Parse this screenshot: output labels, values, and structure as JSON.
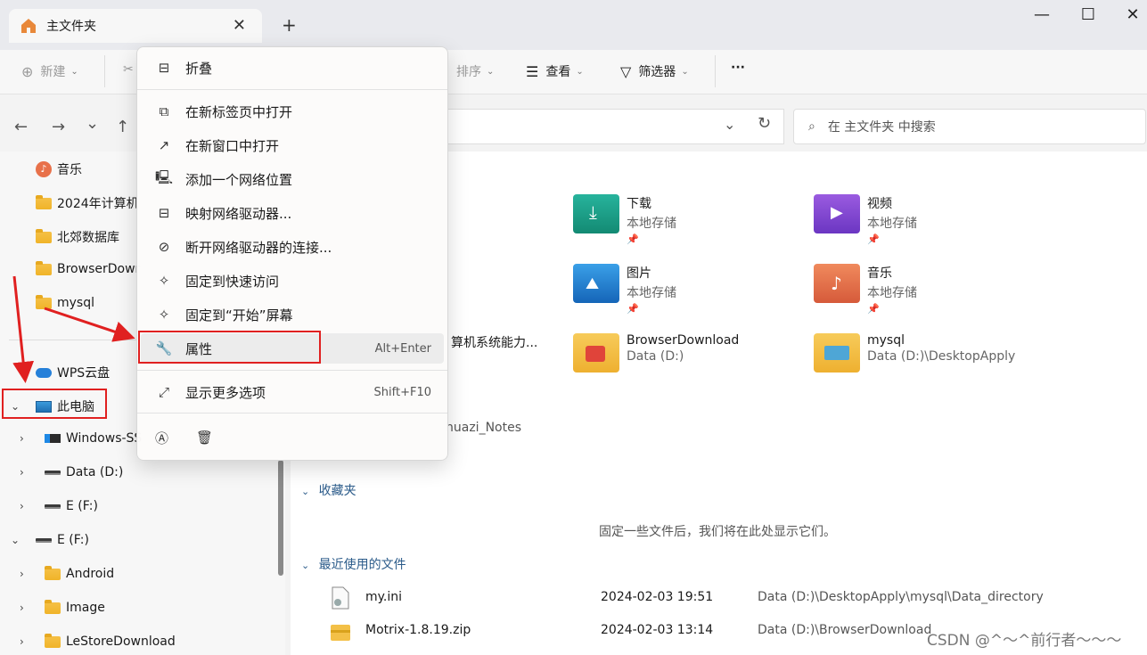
{
  "tab": {
    "title": "主文件夹",
    "close": "✕",
    "new_tab": "+"
  },
  "window": {
    "minimize": "—",
    "maximize": "☐",
    "close": "✕"
  },
  "toolbar": {
    "new": "新建",
    "sort": "排序",
    "view": "查看",
    "filter": "筛选器",
    "more": "···"
  },
  "nav": {
    "back": "←",
    "forward": "→",
    "recent": "⌄",
    "up": "↑",
    "addr_dropdown": "⌄",
    "refresh": "↻"
  },
  "search": {
    "placeholder": "在 主文件夹 中搜索"
  },
  "sidebar": {
    "music": "音乐",
    "folder1": "2024年计算机",
    "folder2": "北郊数据库",
    "folder3": "BrowserDowr",
    "folder4": "mysql",
    "wps": "WPS云盘",
    "this_pc": "此电脑",
    "windows": "Windows-SS",
    "data_d": "Data (D:)",
    "e_f1": "E (F:)",
    "e_f2": "E (F:)",
    "android": "Android",
    "image": "Image",
    "lestore": "LeStoreDownload"
  },
  "tiles": [
    {
      "name": "下载",
      "sub": "本地存储"
    },
    {
      "name": "视频",
      "sub": "本地存储"
    },
    {
      "name": "图片",
      "sub": "本地存储"
    },
    {
      "name": "音乐",
      "sub": "本地存储"
    },
    {
      "name": "BrowserDownload",
      "sub": "Data (D:)"
    },
    {
      "name": "mysql",
      "sub": "Data (D:)\\DesktopApply"
    }
  ],
  "partial": {
    "a": "算机系统能力...",
    "b": "huazi_Notes"
  },
  "sections": {
    "favorites": "收藏夹",
    "recent": "最近使用的文件",
    "empty_note": "固定一些文件后，我们将在此处显示它们。"
  },
  "recent_files": [
    {
      "name": "my.ini",
      "date": "2024-02-03 19:51",
      "path": "Data (D:)\\DesktopApply\\mysql\\Data_directory"
    },
    {
      "name": "Motrix-1.8.19.zip",
      "date": "2024-02-03 13:14",
      "path": "Data (D:)\\BrowserDownload"
    }
  ],
  "context_menu": {
    "collapse": "折叠",
    "open_new_tab": "在新标签页中打开",
    "open_new_window": "在新窗口中打开",
    "add_network_location": "添加一个网络位置",
    "map_network_drive": "映射网络驱动器...",
    "disconnect_network_drive": "断开网络驱动器的连接...",
    "pin_quick_access": "固定到快速访问",
    "pin_start": "固定到“开始”屏幕",
    "properties": "属性",
    "properties_shortcut": "Alt+Enter",
    "show_more": "显示更多选项",
    "show_more_shortcut": "Shift+F10"
  },
  "watermark": "CSDN @^～^前行者～～～",
  "colors": {
    "annotation_red": "#e02020"
  }
}
